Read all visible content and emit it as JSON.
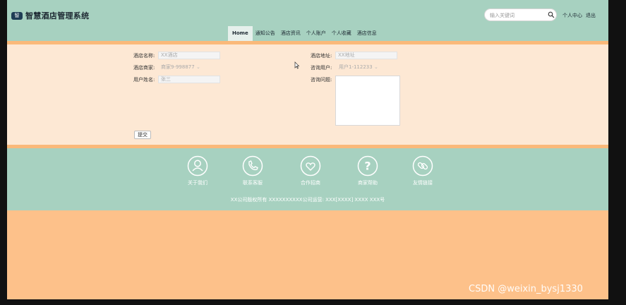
{
  "header": {
    "logo_mark": "智",
    "title": "智慧酒店管理系统",
    "search_placeholder": "输入关键词",
    "user_center": "个人中心",
    "logout": "退出"
  },
  "nav": {
    "items": [
      {
        "label": "Home",
        "active": true
      },
      {
        "label": "通知公告"
      },
      {
        "label": "酒店资讯"
      },
      {
        "label": "个人账户"
      },
      {
        "label": "个人收藏"
      },
      {
        "label": "酒店信息"
      }
    ]
  },
  "form": {
    "hotel_name_label": "酒店名称:",
    "hotel_name_value": "XX酒店",
    "hotel_address_label": "酒店地址:",
    "hotel_address_value": "XX地址",
    "merchant_label": "酒店商家:",
    "merchant_value": "商家9-998877",
    "consult_user_label": "咨询用户:",
    "consult_user_value": "用户1-112233",
    "user_name_label": "用户姓名:",
    "user_name_value": "张三",
    "question_label": "咨询问题:",
    "question_value": "",
    "submit_label": "提交"
  },
  "footer": {
    "items": [
      {
        "label": "关于我们",
        "icon": "person-icon"
      },
      {
        "label": "联系客服",
        "icon": "phone-icon"
      },
      {
        "label": "合作招商",
        "icon": "heart-icon"
      },
      {
        "label": "商家帮助",
        "icon": "question-icon"
      },
      {
        "label": "友情链接",
        "icon": "link-icon"
      }
    ],
    "copyright": "XX公司版权所有 XXXXXXXXXX公司运营: XXX[XXXX] XXXX XXX号"
  },
  "watermark": "CSDN @weixin_bysj1330",
  "colors": {
    "header_bg": "#a7d1c0",
    "form_bg": "#fde8d4",
    "page_bg": "#fdc18a",
    "accent": "#fab97a"
  }
}
